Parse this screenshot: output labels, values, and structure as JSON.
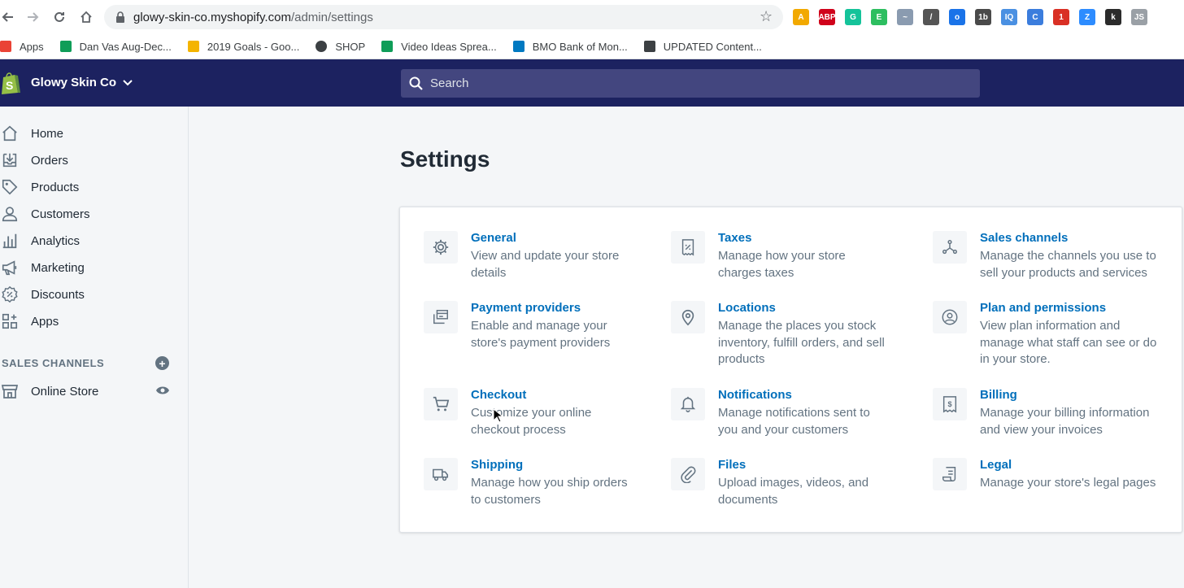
{
  "browser": {
    "url_host": "glowy-skin-co.myshopify.com",
    "url_path": "/admin/settings",
    "bookmarks": [
      {
        "label": "Apps",
        "icon": "apps-grid-icon"
      },
      {
        "label": "Dan Vas Aug-Dec...",
        "icon": "sheets-icon"
      },
      {
        "label": "2019 Goals - Goo...",
        "icon": "drive-icon"
      },
      {
        "label": "SHOP",
        "icon": "globe-icon"
      },
      {
        "label": "Video Ideas Sprea...",
        "icon": "sheets-icon"
      },
      {
        "label": "BMO Bank of Mon...",
        "icon": "bank-icon"
      },
      {
        "label": "UPDATED Content...",
        "icon": "doc-icon"
      }
    ],
    "extensions": [
      {
        "name": "ext-a-icon",
        "color": "#f2a900",
        "text": "A"
      },
      {
        "name": "adblock-icon",
        "color": "#d0021b",
        "text": "ABP"
      },
      {
        "name": "grammarly-icon",
        "color": "#15c39a",
        "text": "G"
      },
      {
        "name": "evernote-icon",
        "color": "#2dbe60",
        "text": "E"
      },
      {
        "name": "ext-chart-icon",
        "color": "#8a9bb0",
        "text": "~"
      },
      {
        "name": "ext-pen-icon",
        "color": "#555555",
        "text": "/"
      },
      {
        "name": "ext-globe-icon",
        "color": "#1a73e8",
        "text": "o"
      },
      {
        "name": "ext-1b-icon",
        "color": "#4a4a4a",
        "text": "1b"
      },
      {
        "name": "ext-iq-icon",
        "color": "#4a90e2",
        "text": "IQ"
      },
      {
        "name": "ext-cal-icon",
        "color": "#3b7ddd",
        "text": "C"
      },
      {
        "name": "ext-red-icon",
        "color": "#d93025",
        "text": "1"
      },
      {
        "name": "zoom-icon",
        "color": "#2d8cff",
        "text": "Z"
      },
      {
        "name": "ext-k-icon",
        "color": "#2b2b2b",
        "text": "k"
      },
      {
        "name": "ext-js-icon",
        "color": "#9aa0a6",
        "text": "JS"
      }
    ]
  },
  "topbar": {
    "store_name": "Glowy Skin Co",
    "search_placeholder": "Search",
    "bg_color": "#1c2260",
    "logo_color": "#95bf47"
  },
  "sidebar": {
    "items": [
      {
        "label": "Home",
        "icon": "home-icon"
      },
      {
        "label": "Orders",
        "icon": "orders-icon"
      },
      {
        "label": "Products",
        "icon": "tag-icon"
      },
      {
        "label": "Customers",
        "icon": "person-icon"
      },
      {
        "label": "Analytics",
        "icon": "bar-chart-icon"
      },
      {
        "label": "Marketing",
        "icon": "megaphone-icon"
      },
      {
        "label": "Discounts",
        "icon": "discount-icon"
      },
      {
        "label": "Apps",
        "icon": "apps-icon"
      }
    ],
    "sales_channels_header": "SALES CHANNELS",
    "online_store_label": "Online Store"
  },
  "main": {
    "title": "Settings",
    "settings": [
      {
        "title": "General",
        "desc": "View and update your store details",
        "icon": "gear-icon"
      },
      {
        "title": "Taxes",
        "desc": "Manage how your store charges taxes",
        "icon": "tax-receipt-icon"
      },
      {
        "title": "Sales channels",
        "desc": "Manage the channels you use to sell your products and services",
        "icon": "channels-icon"
      },
      {
        "title": "Payment providers",
        "desc": "Enable and manage your store's payment providers",
        "icon": "payment-icon"
      },
      {
        "title": "Locations",
        "desc": "Manage the places you stock inventory, fulfill orders, and sell products",
        "icon": "location-pin-icon"
      },
      {
        "title": "Plan and permissions",
        "desc": "View plan information and manage what staff can see or do in your store.",
        "icon": "account-icon"
      },
      {
        "title": "Checkout",
        "desc": "Customize your online checkout process",
        "icon": "cart-icon"
      },
      {
        "title": "Notifications",
        "desc": "Manage notifications sent to you and your customers",
        "icon": "bell-icon"
      },
      {
        "title": "Billing",
        "desc": "Manage your billing information and view your invoices",
        "icon": "billing-icon"
      },
      {
        "title": "Shipping",
        "desc": "Manage how you ship orders to customers",
        "icon": "truck-icon"
      },
      {
        "title": "Files",
        "desc": "Upload images, videos, and documents",
        "icon": "paperclip-icon"
      },
      {
        "title": "Legal",
        "desc": "Manage your store's legal pages",
        "icon": "legal-doc-icon"
      }
    ]
  }
}
